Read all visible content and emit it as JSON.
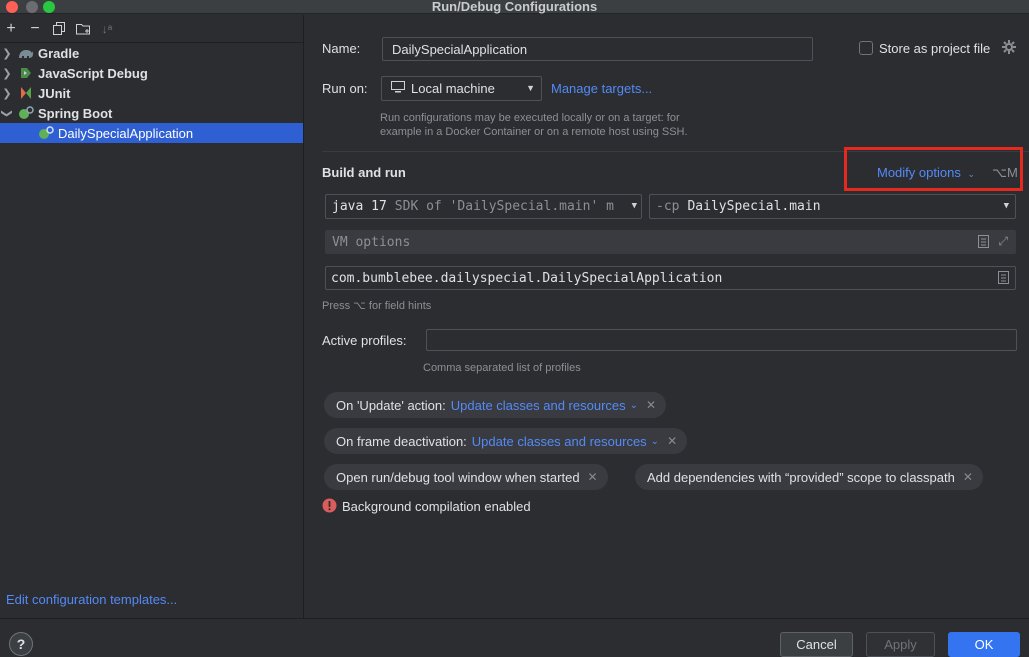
{
  "window": {
    "title": "Run/Debug Configurations"
  },
  "left": {
    "tree": [
      {
        "label": "Gradle",
        "icon": "gradle-icon"
      },
      {
        "label": "JavaScript Debug",
        "icon": "javascript-debug-icon"
      },
      {
        "label": "JUnit",
        "icon": "junit-icon"
      },
      {
        "label": "Spring Boot",
        "icon": "spring-boot-icon"
      },
      {
        "label": "DailySpecialApplication",
        "icon": "spring-boot-app-icon"
      }
    ],
    "edit_templates": "Edit configuration templates..."
  },
  "form": {
    "name_label": "Name:",
    "name_value": "DailySpecialApplication",
    "store_label": "Store as project file",
    "run_on_label": "Run on:",
    "run_on_value": "Local machine",
    "manage_targets": "Manage targets...",
    "run_hint_1": "Run configurations may be executed locally or on a target: for",
    "run_hint_2": "example in a Docker Container or on a remote host using SSH.",
    "build_run_label": "Build and run",
    "modify_options": "Modify options",
    "modify_shortcut": "⌥M",
    "sdk_bold": "java 17",
    "sdk_detail": "SDK of 'DailySpecial.main' m",
    "cp_prefix": "-cp",
    "cp_value": "DailySpecial.main",
    "vm_placeholder": "VM options",
    "main_class": "com.bumblebee.dailyspecial.DailySpecialApplication",
    "field_hint": "Press ⌥ for field hints",
    "profiles_label": "Active profiles:",
    "profiles_value": "",
    "profiles_hint": "Comma separated list of profiles"
  },
  "options": {
    "update_label": "On 'Update' action:",
    "update_value": "Update classes and resources",
    "frame_label": "On frame deactivation:",
    "frame_value": "Update classes and resources",
    "open_tool_window": "Open run/debug tool window when started",
    "add_deps": "Add dependencies with “provided” scope to classpath",
    "bg_compilation": "Background compilation enabled"
  },
  "buttons": {
    "cancel": "Cancel",
    "apply": "Apply",
    "ok": "OK",
    "help": "?"
  },
  "colors": {
    "accent": "#548af7",
    "selection": "#2e5fd3",
    "highlight_box": "#e5291f",
    "error": "#db5c5c"
  }
}
